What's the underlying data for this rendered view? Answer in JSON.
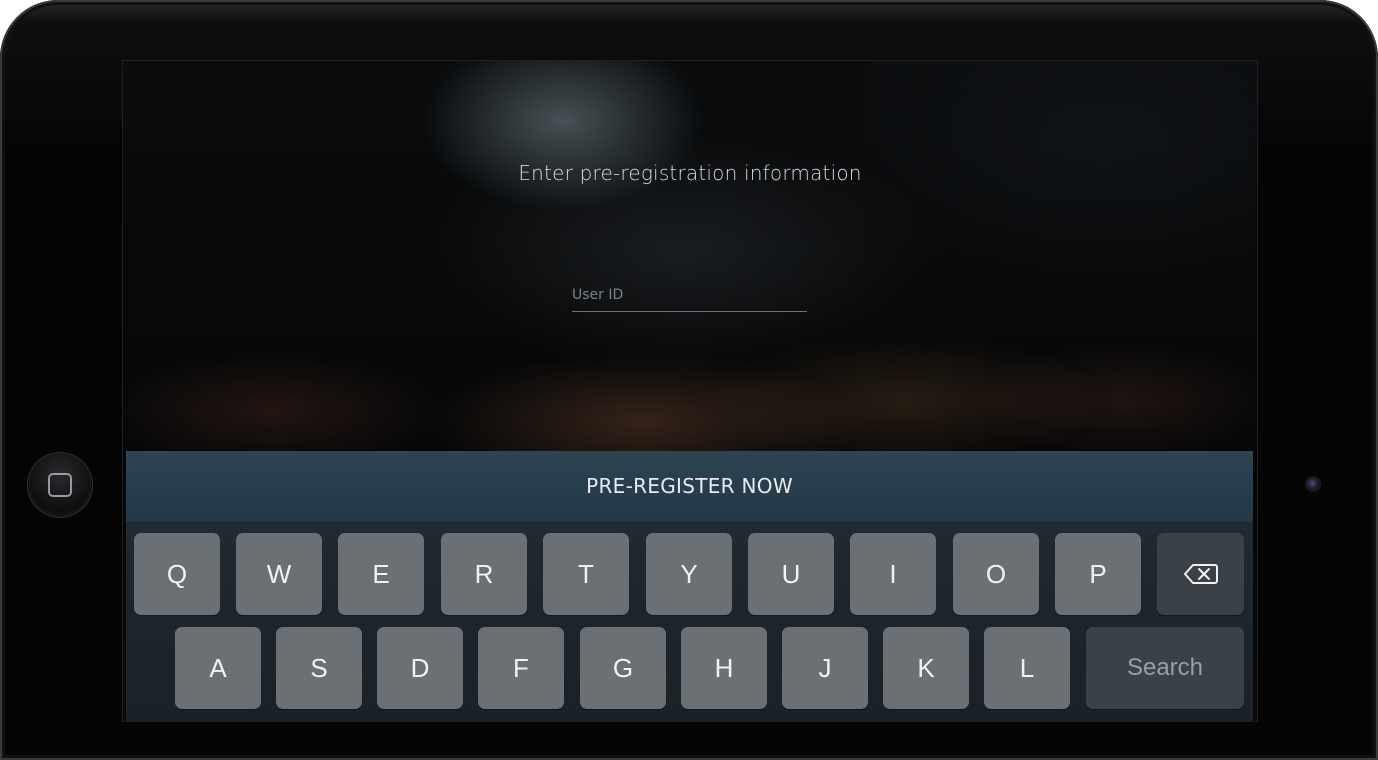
{
  "screen": {
    "title": "Enter pre-registration information",
    "user_id_field": {
      "placeholder": "User ID",
      "value": ""
    },
    "cta_label": "PRE-REGISTER NOW"
  },
  "keyboard": {
    "row1": [
      "Q",
      "W",
      "E",
      "R",
      "T",
      "Y",
      "U",
      "I",
      "O",
      "P"
    ],
    "row2": [
      "A",
      "S",
      "D",
      "F",
      "G",
      "H",
      "J",
      "K",
      "L"
    ],
    "backspace_icon": "backspace-icon",
    "search_label": "Search"
  },
  "device": {
    "home_button_icon": "home-button-icon",
    "camera_icon": "front-camera-icon"
  },
  "colors": {
    "cta_background": "#2d4452",
    "key_light": "#6a7074",
    "key_dark": "#3b4247",
    "keyboard_background": "#1f272d"
  }
}
